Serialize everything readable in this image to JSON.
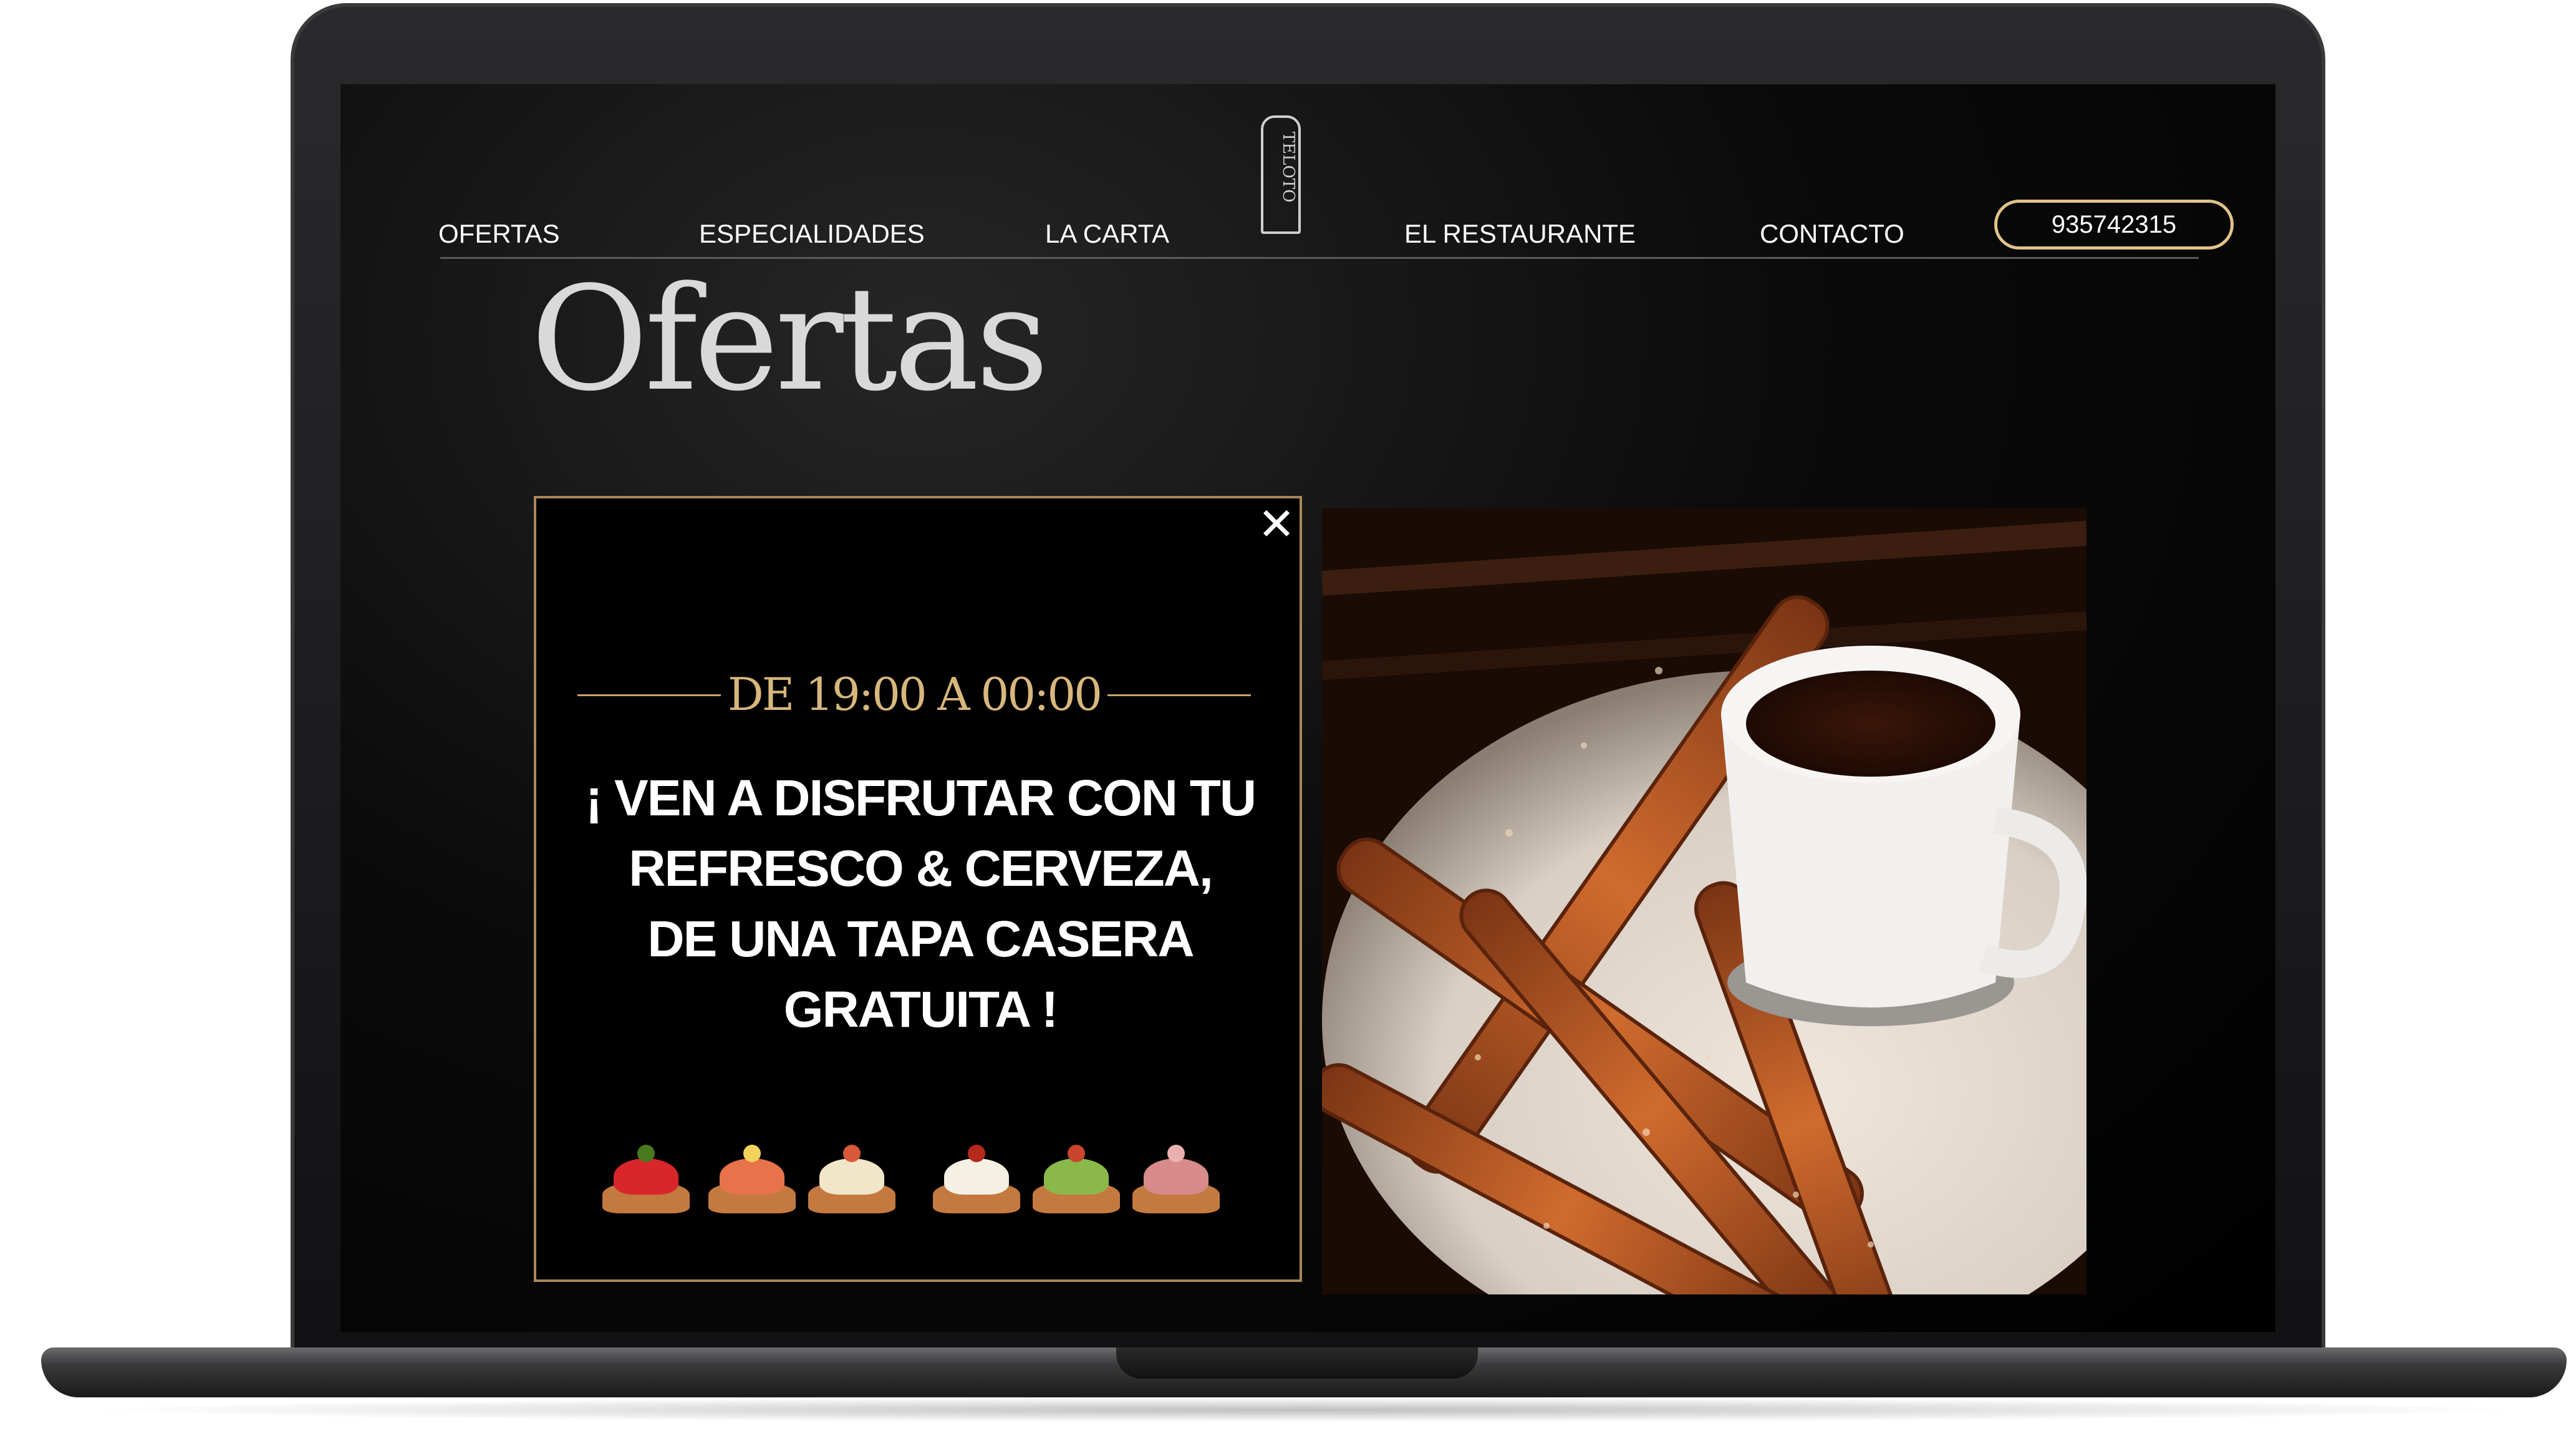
{
  "nav": {
    "items": [
      {
        "label": "OFERTAS"
      },
      {
        "label": "ESPECIALIDADES"
      },
      {
        "label": "LA CARTA"
      },
      {
        "label": "EL RESTAURANTE"
      },
      {
        "label": "CONTACTO"
      }
    ],
    "logo_text": "TELOTO",
    "phone": "935742315"
  },
  "page": {
    "title": "Ofertas"
  },
  "offer": {
    "time": "DE 19:00 A 00:00",
    "promo_lines": [
      "¡ VEN A DISFRUTAR CON TU",
      "REFRESCO & CERVEZA,",
      "DE UNA TAPA CASERA",
      "GRATUITA !"
    ],
    "close_icon": "close-icon",
    "tapas": [
      {
        "topping": "#d9262b",
        "garnish": "#4a7a1e"
      },
      {
        "topping": "#e8734a",
        "garnish": "#f2d25a"
      },
      {
        "topping": "#f2e6c9",
        "garnish": "#d8593a"
      },
      {
        "topping": "#f4f0e4",
        "garnish": "#b52a1a"
      },
      {
        "topping": "#8bb84a",
        "garnish": "#c9452e"
      },
      {
        "topping": "#d98a8a",
        "garnish": "#e8b0b0"
      }
    ]
  },
  "photo": {
    "subject": "churros-with-chocolate-image"
  },
  "colors": {
    "accent_gold": "#d8b77c",
    "border_gold": "#a9885a",
    "background": "#000000"
  }
}
